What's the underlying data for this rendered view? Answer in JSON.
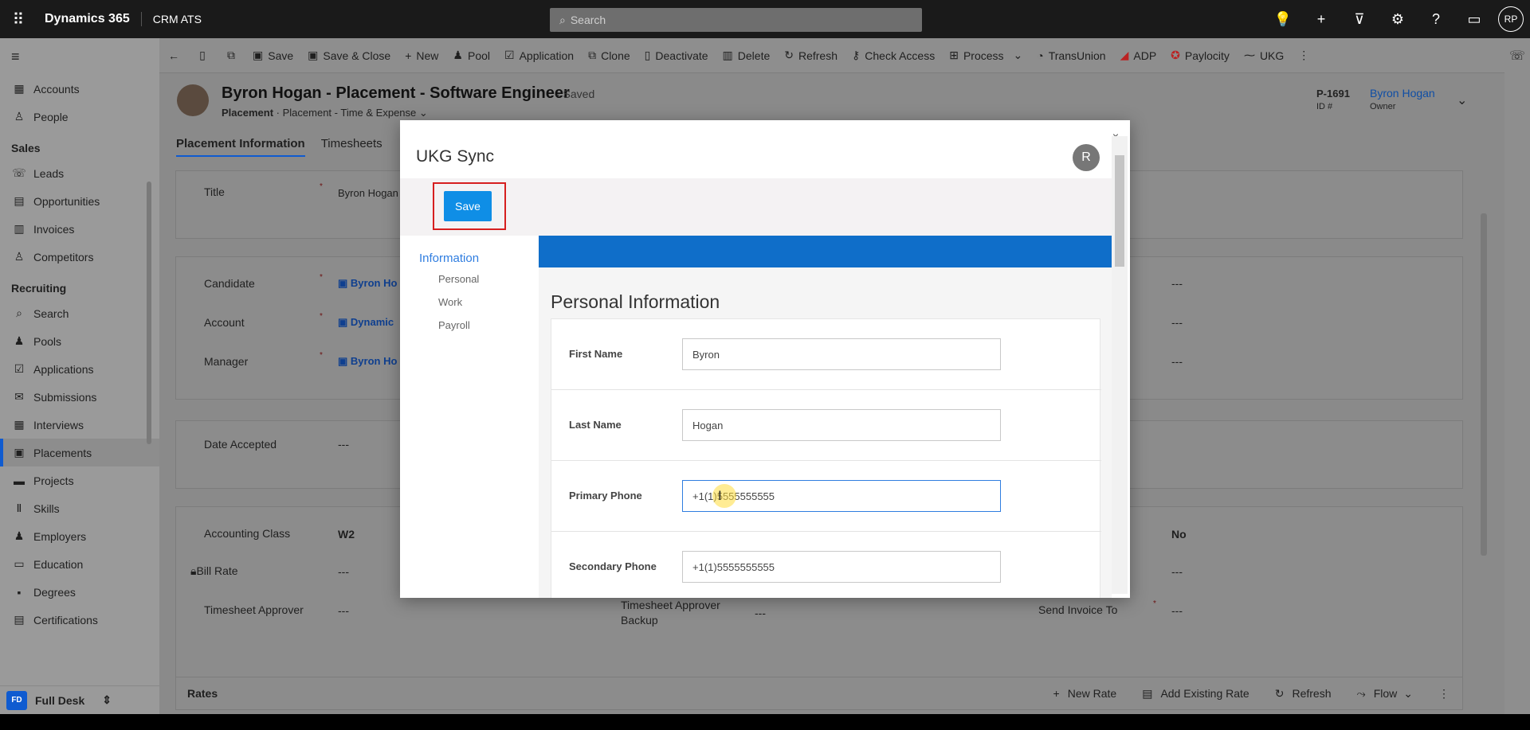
{
  "topbar": {
    "brand": "Dynamics 365",
    "app_name": "CRM ATS",
    "search_placeholder": "Search",
    "user_initials": "RP"
  },
  "sitemap": {
    "items_top": [
      {
        "label": "Accounts",
        "icon": "building-icon"
      },
      {
        "label": "People",
        "icon": "person-icon"
      }
    ],
    "group_sales": "Sales",
    "items_sales": [
      {
        "label": "Leads",
        "icon": "phone-icon"
      },
      {
        "label": "Opportunities",
        "icon": "document-icon"
      },
      {
        "label": "Invoices",
        "icon": "invoice-icon"
      },
      {
        "label": "Competitors",
        "icon": "person-icon"
      }
    ],
    "group_recruiting": "Recruiting",
    "items_recruiting": [
      {
        "label": "Search",
        "icon": "search-icon"
      },
      {
        "label": "Pools",
        "icon": "people-icon"
      },
      {
        "label": "Applications",
        "icon": "checklist-icon"
      },
      {
        "label": "Submissions",
        "icon": "mail-icon"
      },
      {
        "label": "Interviews",
        "icon": "calendar-icon"
      },
      {
        "label": "Placements",
        "icon": "briefcase-icon"
      },
      {
        "label": "Projects",
        "icon": "folder-icon"
      },
      {
        "label": "Skills",
        "icon": "skills-icon"
      },
      {
        "label": "Employers",
        "icon": "people-icon"
      },
      {
        "label": "Education",
        "icon": "abc-icon"
      },
      {
        "label": "Degrees",
        "icon": "degree-icon"
      },
      {
        "label": "Certifications",
        "icon": "certificate-icon"
      }
    ],
    "area_badge": "FD",
    "area_name": "Full Desk"
  },
  "commandbar": {
    "save": "Save",
    "save_close": "Save & Close",
    "new": "New",
    "pool": "Pool",
    "application": "Application",
    "clone": "Clone",
    "deactivate": "Deactivate",
    "delete": "Delete",
    "refresh": "Refresh",
    "check_access": "Check Access",
    "process": "Process",
    "transunion": "TransUnion",
    "adp": "ADP",
    "paylocity": "Paylocity",
    "ukg": "UKG"
  },
  "record": {
    "title": "Byron Hogan - Placement - Software Engineer",
    "saved_status": "- Saved",
    "entity": "Placement",
    "form_name": "Placement - Time & Expense",
    "id_value": "P-1691",
    "id_label": "ID #",
    "owner_name": "Byron Hogan",
    "owner_label": "Owner",
    "tabs": [
      "Placement Information",
      "Timesheets"
    ]
  },
  "form": {
    "title_label": "Title",
    "title_value": "Byron Hogan",
    "candidate_label": "Candidate",
    "candidate_value": "Byron Ho",
    "account_label": "Account",
    "account_value": "Dynamic",
    "manager_label": "Manager",
    "manager_value": "Byron Ho",
    "date_accepted_label": "Date Accepted",
    "date_accepted_value": "---",
    "accounting_class_label": "Accounting Class",
    "accounting_class_value": "W2",
    "bill_rate_label": "Bill Rate",
    "bill_rate_value": "---",
    "timesheet_approver_label": "Timesheet Approver",
    "timesheet_approver_value": "---",
    "timesheet_backup_label": "Timesheet Approver Backup",
    "timesheet_backup_value": "---",
    "send_invoice_label": "Send Invoice To",
    "send_invoice_value": "---",
    "right_values": [
      "---",
      "---",
      "---",
      "No",
      "---"
    ],
    "required_star": "*"
  },
  "rates": {
    "title": "Rates",
    "new_rate": "New Rate",
    "add_existing": "Add Existing Rate",
    "refresh": "Refresh",
    "flow": "Flow"
  },
  "dialog": {
    "title": "UKG Sync",
    "close_glyph": "×",
    "avatar_initial": "R",
    "save_label": "Save",
    "nav_head": "Information",
    "nav_items": [
      "Personal",
      "Work",
      "Payroll"
    ],
    "section_title": "Personal Information",
    "fields": [
      {
        "label": "First Name",
        "value": "Byron"
      },
      {
        "label": "Last Name",
        "value": "Hogan"
      },
      {
        "label": "Primary Phone",
        "value": "+1(1)5555555555"
      },
      {
        "label": "Secondary Phone",
        "value": "+1(1)5555555555"
      }
    ]
  },
  "colors": {
    "accent_blue": "#0f6ec9",
    "save_button": "#0f8ee6",
    "highlight_box": "#d61f1f"
  }
}
